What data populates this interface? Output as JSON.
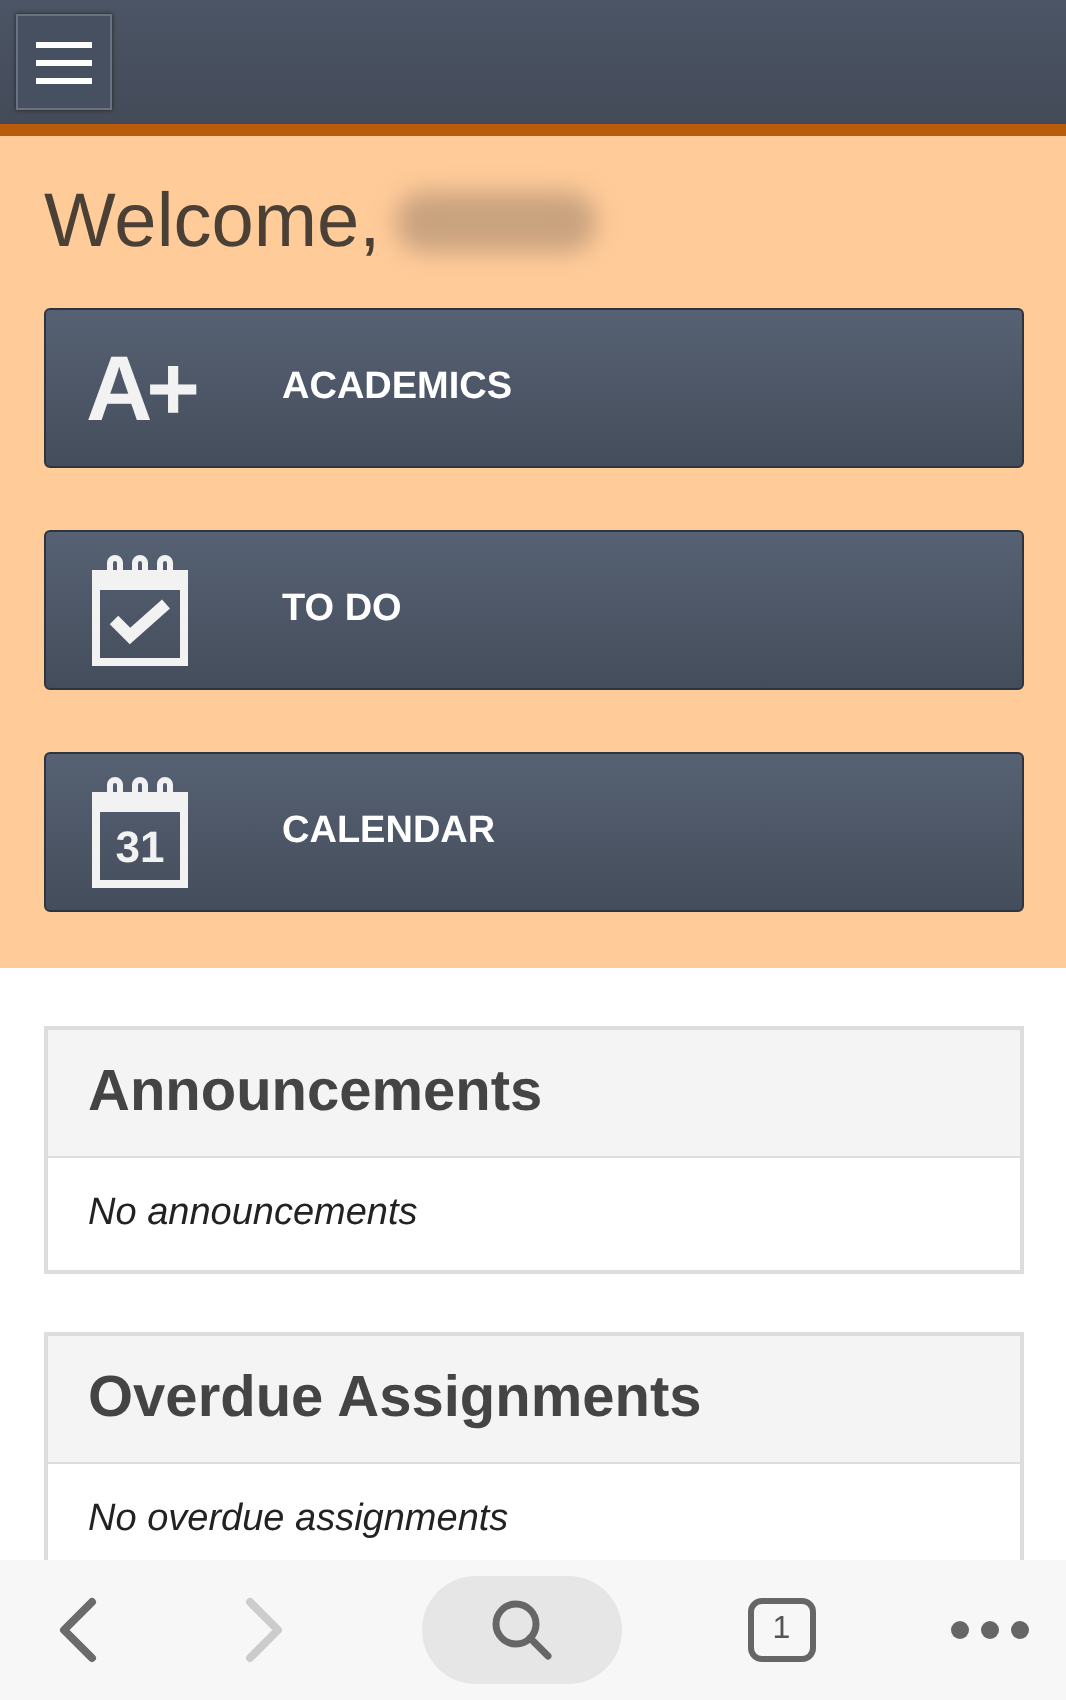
{
  "welcome": {
    "greeting": "Welcome,",
    "name_redacted": true
  },
  "nav_buttons": [
    {
      "label": "ACADEMICS",
      "kind": "grade",
      "icon_text": "A+"
    },
    {
      "label": "TO DO",
      "kind": "todo"
    },
    {
      "label": "CALENDAR",
      "kind": "calendar",
      "icon_text": "31"
    }
  ],
  "panels": [
    {
      "title": "Announcements",
      "message": "No announcements"
    },
    {
      "title": "Overdue Assignments",
      "message": "No overdue assignments"
    }
  ],
  "browser_bar": {
    "back_disabled": false,
    "forward_disabled": true,
    "tab_count": "1"
  }
}
